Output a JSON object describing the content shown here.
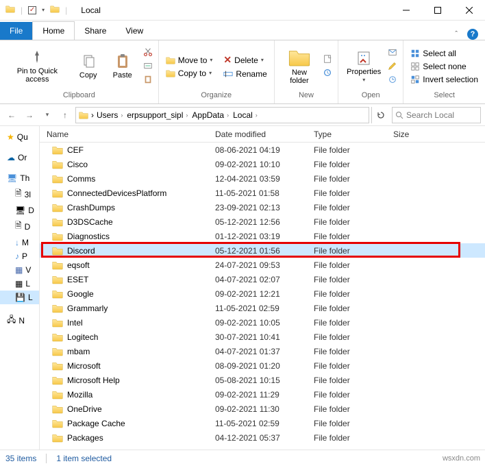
{
  "window": {
    "title": "Local"
  },
  "tabs": {
    "file": "File",
    "home": "Home",
    "share": "Share",
    "view": "View"
  },
  "ribbon": {
    "clipboard": {
      "label": "Clipboard",
      "pin": "Pin to Quick access",
      "copy": "Copy",
      "paste": "Paste"
    },
    "organize": {
      "label": "Organize",
      "moveto": "Move to",
      "copyto": "Copy to",
      "delete": "Delete",
      "rename": "Rename"
    },
    "new": {
      "label": "New",
      "newfolder": "New folder"
    },
    "open": {
      "label": "Open",
      "properties": "Properties"
    },
    "select": {
      "label": "Select",
      "all": "Select all",
      "none": "Select none",
      "invert": "Invert selection"
    }
  },
  "breadcrumb": [
    "Users",
    "erpsupport_sipl",
    "AppData",
    "Local"
  ],
  "search": {
    "placeholder": "Search Local"
  },
  "columns": {
    "name": "Name",
    "date": "Date modified",
    "type": "Type",
    "size": "Size"
  },
  "sidebar": {
    "quick": "Qu",
    "onedrive": "Or",
    "thispc": "Th",
    "items": [
      "3l",
      "D",
      "D",
      "M",
      "P",
      "V",
      "L",
      "N"
    ]
  },
  "rows": [
    {
      "name": "CEF",
      "date": "08-06-2021 04:19",
      "type": "File folder"
    },
    {
      "name": "Cisco",
      "date": "09-02-2021 10:10",
      "type": "File folder"
    },
    {
      "name": "Comms",
      "date": "12-04-2021 03:59",
      "type": "File folder"
    },
    {
      "name": "ConnectedDevicesPlatform",
      "date": "11-05-2021 01:58",
      "type": "File folder"
    },
    {
      "name": "CrashDumps",
      "date": "23-09-2021 02:13",
      "type": "File folder"
    },
    {
      "name": "D3DSCache",
      "date": "05-12-2021 12:56",
      "type": "File folder"
    },
    {
      "name": "Diagnostics",
      "date": "01-12-2021 03:19",
      "type": "File folder"
    },
    {
      "name": "Discord",
      "date": "05-12-2021 01:56",
      "type": "File folder",
      "selected": true,
      "highlighted": true
    },
    {
      "name": "eqsoft",
      "date": "24-07-2021 09:53",
      "type": "File folder"
    },
    {
      "name": "ESET",
      "date": "04-07-2021 02:07",
      "type": "File folder"
    },
    {
      "name": "Google",
      "date": "09-02-2021 12:21",
      "type": "File folder"
    },
    {
      "name": "Grammarly",
      "date": "11-05-2021 02:59",
      "type": "File folder"
    },
    {
      "name": "Intel",
      "date": "09-02-2021 10:05",
      "type": "File folder"
    },
    {
      "name": "Logitech",
      "date": "30-07-2021 10:41",
      "type": "File folder"
    },
    {
      "name": "mbam",
      "date": "04-07-2021 01:37",
      "type": "File folder"
    },
    {
      "name": "Microsoft",
      "date": "08-09-2021 01:20",
      "type": "File folder"
    },
    {
      "name": "Microsoft Help",
      "date": "05-08-2021 10:15",
      "type": "File folder"
    },
    {
      "name": "Mozilla",
      "date": "09-02-2021 11:29",
      "type": "File folder"
    },
    {
      "name": "OneDrive",
      "date": "09-02-2021 11:30",
      "type": "File folder"
    },
    {
      "name": "Package Cache",
      "date": "11-05-2021 02:59",
      "type": "File folder"
    },
    {
      "name": "Packages",
      "date": "04-12-2021 05:37",
      "type": "File folder"
    }
  ],
  "status": {
    "items": "35 items",
    "selected": "1 item selected"
  },
  "watermark": "wsxdn.com"
}
